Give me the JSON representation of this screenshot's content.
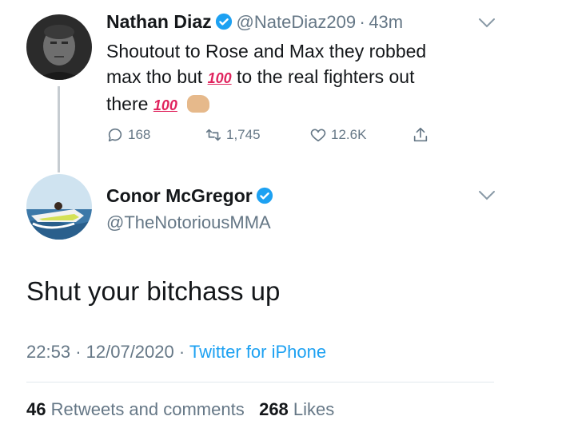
{
  "tweet1": {
    "author": "Nathan Diaz",
    "handle": "@NateDiaz209",
    "dot": "·",
    "time": "43m",
    "text_1": "Shoutout to Rose and Max they robbed",
    "text_2a": "max tho but",
    "emoji_100": "100",
    "text_2b": "to the real fighters out",
    "text_3": "there",
    "actions": {
      "replies": "168",
      "retweets": "1,745",
      "likes": "12.6K"
    }
  },
  "tweet2": {
    "author": "Conor McGregor",
    "handle": "@TheNotoriousMMA",
    "text": "Shut your bitchass up",
    "time": "22:53",
    "sep": "·",
    "date": "12/07/2020",
    "source": "Twitter for iPhone",
    "retweets_count": "46",
    "retweets_label": "Retweets and comments",
    "likes_count": "268",
    "likes_label": "Likes"
  },
  "colors": {
    "verified": "#1da1f2",
    "hundred": "#e0245e",
    "secondary_text": "#657786"
  }
}
